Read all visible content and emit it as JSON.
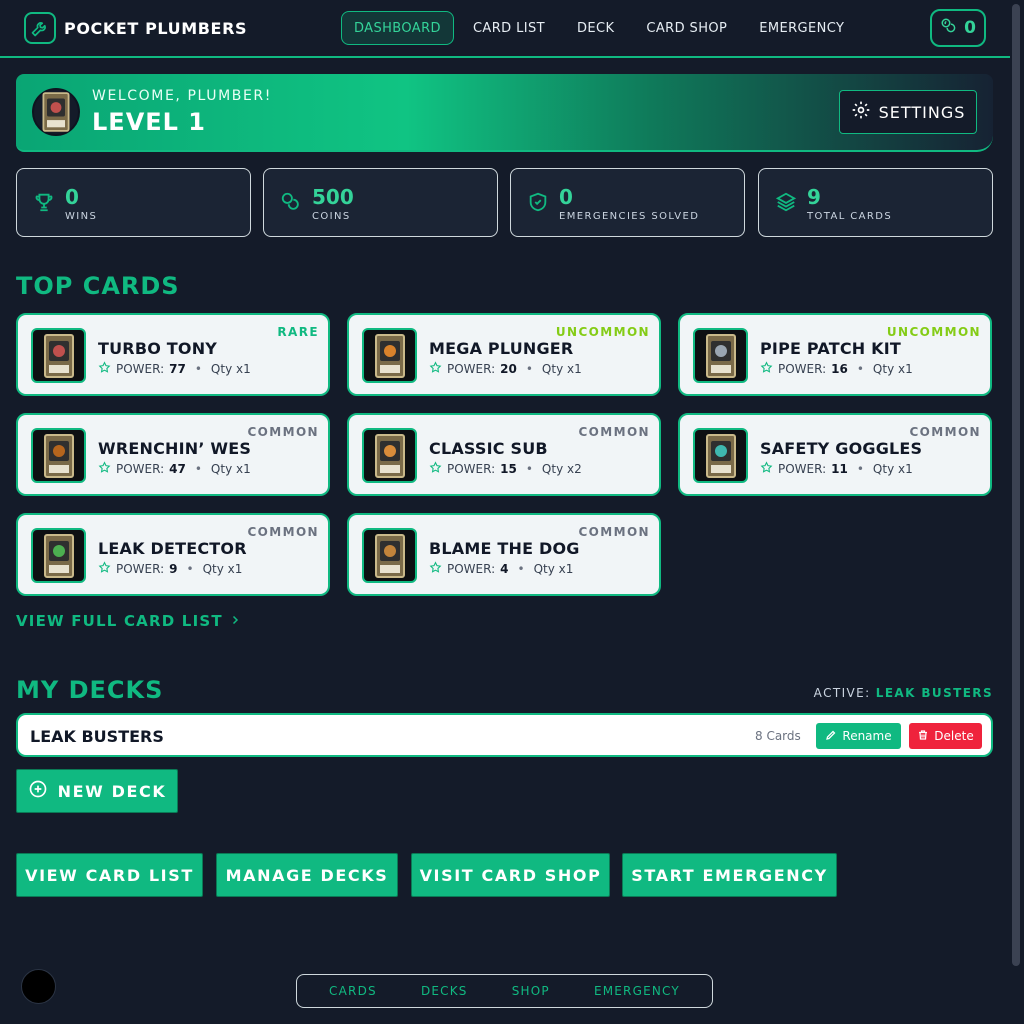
{
  "app": {
    "brand": "POCKET PLUMBERS",
    "coins_badge": "0",
    "accent_color": "#10b981"
  },
  "nav": {
    "items": [
      "DASHBOARD",
      "CARD LIST",
      "DECK",
      "CARD SHOP",
      "EMERGENCY"
    ],
    "active": "DASHBOARD"
  },
  "banner": {
    "welcome": "WELCOME, PLUMBER!",
    "level": "LEVEL 1",
    "settings_label": "SETTINGS"
  },
  "stats": [
    {
      "value": "0",
      "label": "WINS",
      "icon": "trophy-icon"
    },
    {
      "value": "500",
      "label": "COINS",
      "icon": "coins-icon"
    },
    {
      "value": "0",
      "label": "EMERGENCIES SOLVED",
      "icon": "shield-check-icon"
    },
    {
      "value": "9",
      "label": "TOTAL CARDS",
      "icon": "layers-icon"
    }
  ],
  "top_cards": {
    "title": "TOP CARDS",
    "power_label": "POWER:",
    "cards": [
      {
        "name": "TURBO TONY",
        "rarity": "RARE",
        "power": "77",
        "qty": "Qty x1"
      },
      {
        "name": "MEGA PLUNGER",
        "rarity": "UNCOMMON",
        "power": "20",
        "qty": "Qty x1"
      },
      {
        "name": "PIPE PATCH KIT",
        "rarity": "UNCOMMON",
        "power": "16",
        "qty": "Qty x1"
      },
      {
        "name": "WRENCHIN’ WES",
        "rarity": "COMMON",
        "power": "47",
        "qty": "Qty x1"
      },
      {
        "name": "CLASSIC SUB",
        "rarity": "COMMON",
        "power": "15",
        "qty": "Qty x2"
      },
      {
        "name": "SAFETY GOGGLES",
        "rarity": "COMMON",
        "power": "11",
        "qty": "Qty x1"
      },
      {
        "name": "LEAK DETECTOR",
        "rarity": "COMMON",
        "power": "9",
        "qty": "Qty x1"
      },
      {
        "name": "BLAME THE DOG",
        "rarity": "COMMON",
        "power": "4",
        "qty": "Qty x1"
      }
    ],
    "view_full": "VIEW FULL CARD LIST"
  },
  "decks": {
    "title": "MY DECKS",
    "active_label": "ACTIVE:",
    "active_name": "LEAK BUSTERS",
    "rows": [
      {
        "name": "LEAK BUSTERS",
        "count": "8 Cards",
        "rename": "Rename",
        "delete": "Delete"
      }
    ],
    "new_deck": "NEW DECK"
  },
  "quick_actions": [
    "VIEW CARD LIST",
    "MANAGE DECKS",
    "VISIT CARD SHOP",
    "START EMERGENCY"
  ],
  "bottom_nav": [
    "CARDS",
    "DECKS",
    "SHOP",
    "EMERGENCY"
  ]
}
